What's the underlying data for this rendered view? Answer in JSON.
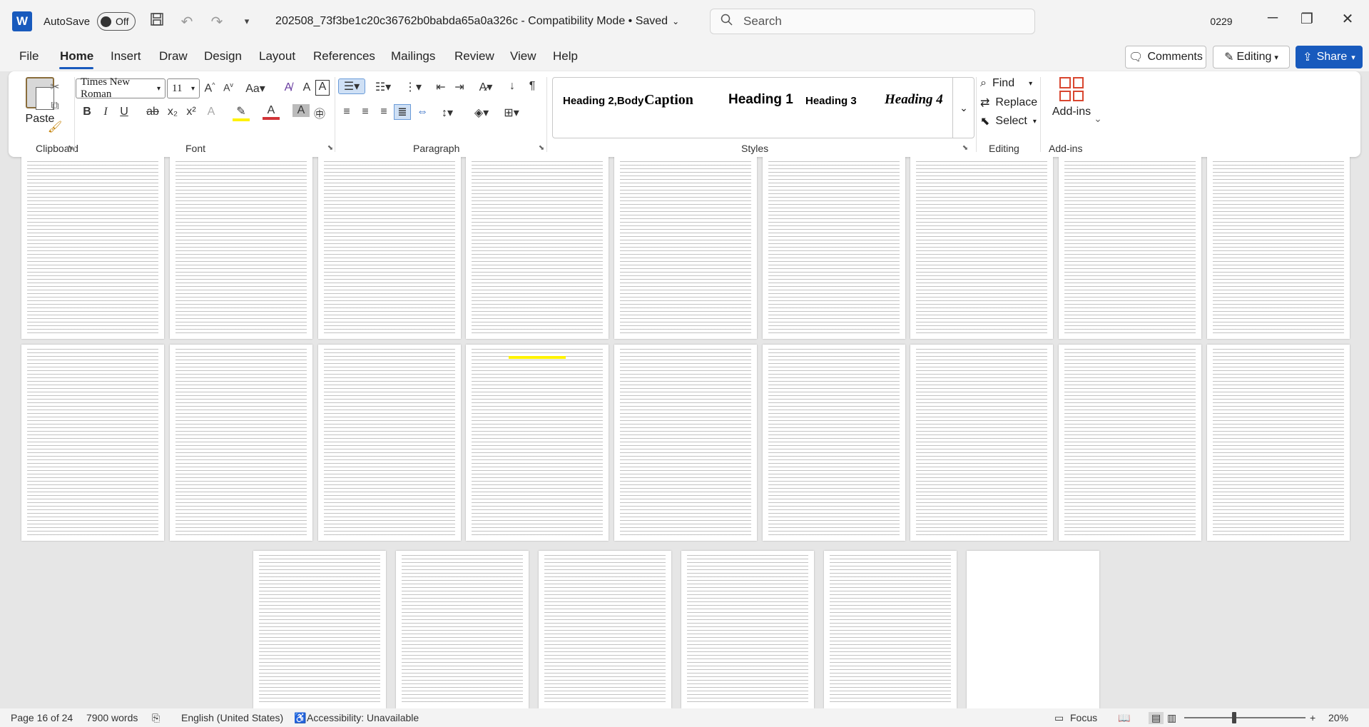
{
  "titlebar": {
    "app_icon": "W",
    "autosave_label": "AutoSave",
    "autosave_state": "Off",
    "document_title": "202508_73f3be1c20c36762b0babda65a0a326c  -  Compatibility Mode  •  Saved",
    "search_placeholder": "Search",
    "user_initials": "0229"
  },
  "menu": {
    "tabs": [
      "File",
      "Home",
      "Insert",
      "Draw",
      "Design",
      "Layout",
      "References",
      "Mailings",
      "Review",
      "View",
      "Help"
    ],
    "active_tab": "Home",
    "comments_label": "Comments",
    "editing_label": "Editing",
    "share_label": "Share"
  },
  "ribbon": {
    "clipboard": {
      "paste_label": "Paste",
      "group_label": "Clipboard"
    },
    "font": {
      "font_name": "Times New Roman",
      "font_size": "11",
      "group_label": "Font"
    },
    "paragraph": {
      "group_label": "Paragraph"
    },
    "styles": {
      "items": [
        "Heading 2,Body",
        "Caption",
        "Heading 1",
        "Heading 3",
        "Heading 4"
      ],
      "group_label": "Styles"
    },
    "editing": {
      "find_label": "Find",
      "replace_label": "Replace",
      "select_label": "Select",
      "group_label": "Editing"
    },
    "addins": {
      "button_label": "Add-ins",
      "group_label": "Add-ins"
    }
  },
  "statusbar": {
    "page_info": "Page 16 of 24",
    "word_count": "7900 words",
    "language": "English (United States)",
    "accessibility": "Accessibility: Unavailable",
    "focus_label": "Focus",
    "zoom_level": "20%"
  },
  "colors": {
    "brand": "#185abd",
    "highlight": "#fff200"
  }
}
